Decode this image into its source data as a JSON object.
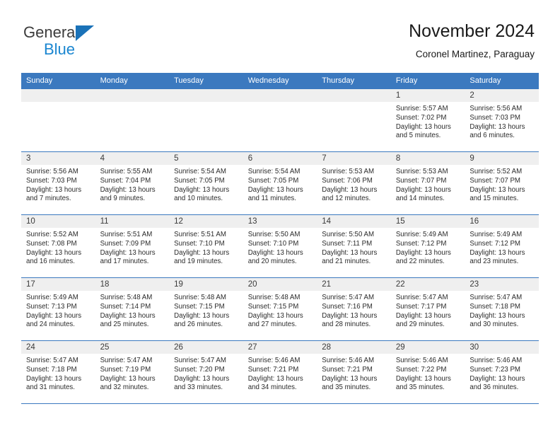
{
  "brand": {
    "name_top": "General",
    "name_bottom": "Blue",
    "accent_color": "#1a86d0",
    "triangle_color": "#1a72b8"
  },
  "header": {
    "title": "November 2024",
    "subtitle": "Coronel Martinez, Paraguay"
  },
  "theme": {
    "header_bg": "#3b79bf",
    "daynum_bg": "#efefef",
    "cell_bg": "#ffffff",
    "text_color": "#2b2b2b"
  },
  "weekdays": [
    "Sunday",
    "Monday",
    "Tuesday",
    "Wednesday",
    "Thursday",
    "Friday",
    "Saturday"
  ],
  "labels": {
    "sunrise": "Sunrise:",
    "sunset": "Sunset:",
    "daylight": "Daylight:"
  },
  "weeks": [
    [
      {
        "day": "",
        "sunrise": "",
        "sunset": "",
        "daylight1": "",
        "daylight2": ""
      },
      {
        "day": "",
        "sunrise": "",
        "sunset": "",
        "daylight1": "",
        "daylight2": ""
      },
      {
        "day": "",
        "sunrise": "",
        "sunset": "",
        "daylight1": "",
        "daylight2": ""
      },
      {
        "day": "",
        "sunrise": "",
        "sunset": "",
        "daylight1": "",
        "daylight2": ""
      },
      {
        "day": "",
        "sunrise": "",
        "sunset": "",
        "daylight1": "",
        "daylight2": ""
      },
      {
        "day": "1",
        "sunrise": "Sunrise: 5:57 AM",
        "sunset": "Sunset: 7:02 PM",
        "daylight1": "Daylight: 13 hours",
        "daylight2": "and 5 minutes."
      },
      {
        "day": "2",
        "sunrise": "Sunrise: 5:56 AM",
        "sunset": "Sunset: 7:03 PM",
        "daylight1": "Daylight: 13 hours",
        "daylight2": "and 6 minutes."
      }
    ],
    [
      {
        "day": "3",
        "sunrise": "Sunrise: 5:56 AM",
        "sunset": "Sunset: 7:03 PM",
        "daylight1": "Daylight: 13 hours",
        "daylight2": "and 7 minutes."
      },
      {
        "day": "4",
        "sunrise": "Sunrise: 5:55 AM",
        "sunset": "Sunset: 7:04 PM",
        "daylight1": "Daylight: 13 hours",
        "daylight2": "and 9 minutes."
      },
      {
        "day": "5",
        "sunrise": "Sunrise: 5:54 AM",
        "sunset": "Sunset: 7:05 PM",
        "daylight1": "Daylight: 13 hours",
        "daylight2": "and 10 minutes."
      },
      {
        "day": "6",
        "sunrise": "Sunrise: 5:54 AM",
        "sunset": "Sunset: 7:05 PM",
        "daylight1": "Daylight: 13 hours",
        "daylight2": "and 11 minutes."
      },
      {
        "day": "7",
        "sunrise": "Sunrise: 5:53 AM",
        "sunset": "Sunset: 7:06 PM",
        "daylight1": "Daylight: 13 hours",
        "daylight2": "and 12 minutes."
      },
      {
        "day": "8",
        "sunrise": "Sunrise: 5:53 AM",
        "sunset": "Sunset: 7:07 PM",
        "daylight1": "Daylight: 13 hours",
        "daylight2": "and 14 minutes."
      },
      {
        "day": "9",
        "sunrise": "Sunrise: 5:52 AM",
        "sunset": "Sunset: 7:07 PM",
        "daylight1": "Daylight: 13 hours",
        "daylight2": "and 15 minutes."
      }
    ],
    [
      {
        "day": "10",
        "sunrise": "Sunrise: 5:52 AM",
        "sunset": "Sunset: 7:08 PM",
        "daylight1": "Daylight: 13 hours",
        "daylight2": "and 16 minutes."
      },
      {
        "day": "11",
        "sunrise": "Sunrise: 5:51 AM",
        "sunset": "Sunset: 7:09 PM",
        "daylight1": "Daylight: 13 hours",
        "daylight2": "and 17 minutes."
      },
      {
        "day": "12",
        "sunrise": "Sunrise: 5:51 AM",
        "sunset": "Sunset: 7:10 PM",
        "daylight1": "Daylight: 13 hours",
        "daylight2": "and 19 minutes."
      },
      {
        "day": "13",
        "sunrise": "Sunrise: 5:50 AM",
        "sunset": "Sunset: 7:10 PM",
        "daylight1": "Daylight: 13 hours",
        "daylight2": "and 20 minutes."
      },
      {
        "day": "14",
        "sunrise": "Sunrise: 5:50 AM",
        "sunset": "Sunset: 7:11 PM",
        "daylight1": "Daylight: 13 hours",
        "daylight2": "and 21 minutes."
      },
      {
        "day": "15",
        "sunrise": "Sunrise: 5:49 AM",
        "sunset": "Sunset: 7:12 PM",
        "daylight1": "Daylight: 13 hours",
        "daylight2": "and 22 minutes."
      },
      {
        "day": "16",
        "sunrise": "Sunrise: 5:49 AM",
        "sunset": "Sunset: 7:12 PM",
        "daylight1": "Daylight: 13 hours",
        "daylight2": "and 23 minutes."
      }
    ],
    [
      {
        "day": "17",
        "sunrise": "Sunrise: 5:49 AM",
        "sunset": "Sunset: 7:13 PM",
        "daylight1": "Daylight: 13 hours",
        "daylight2": "and 24 minutes."
      },
      {
        "day": "18",
        "sunrise": "Sunrise: 5:48 AM",
        "sunset": "Sunset: 7:14 PM",
        "daylight1": "Daylight: 13 hours",
        "daylight2": "and 25 minutes."
      },
      {
        "day": "19",
        "sunrise": "Sunrise: 5:48 AM",
        "sunset": "Sunset: 7:15 PM",
        "daylight1": "Daylight: 13 hours",
        "daylight2": "and 26 minutes."
      },
      {
        "day": "20",
        "sunrise": "Sunrise: 5:48 AM",
        "sunset": "Sunset: 7:15 PM",
        "daylight1": "Daylight: 13 hours",
        "daylight2": "and 27 minutes."
      },
      {
        "day": "21",
        "sunrise": "Sunrise: 5:47 AM",
        "sunset": "Sunset: 7:16 PM",
        "daylight1": "Daylight: 13 hours",
        "daylight2": "and 28 minutes."
      },
      {
        "day": "22",
        "sunrise": "Sunrise: 5:47 AM",
        "sunset": "Sunset: 7:17 PM",
        "daylight1": "Daylight: 13 hours",
        "daylight2": "and 29 minutes."
      },
      {
        "day": "23",
        "sunrise": "Sunrise: 5:47 AM",
        "sunset": "Sunset: 7:18 PM",
        "daylight1": "Daylight: 13 hours",
        "daylight2": "and 30 minutes."
      }
    ],
    [
      {
        "day": "24",
        "sunrise": "Sunrise: 5:47 AM",
        "sunset": "Sunset: 7:18 PM",
        "daylight1": "Daylight: 13 hours",
        "daylight2": "and 31 minutes."
      },
      {
        "day": "25",
        "sunrise": "Sunrise: 5:47 AM",
        "sunset": "Sunset: 7:19 PM",
        "daylight1": "Daylight: 13 hours",
        "daylight2": "and 32 minutes."
      },
      {
        "day": "26",
        "sunrise": "Sunrise: 5:47 AM",
        "sunset": "Sunset: 7:20 PM",
        "daylight1": "Daylight: 13 hours",
        "daylight2": "and 33 minutes."
      },
      {
        "day": "27",
        "sunrise": "Sunrise: 5:46 AM",
        "sunset": "Sunset: 7:21 PM",
        "daylight1": "Daylight: 13 hours",
        "daylight2": "and 34 minutes."
      },
      {
        "day": "28",
        "sunrise": "Sunrise: 5:46 AM",
        "sunset": "Sunset: 7:21 PM",
        "daylight1": "Daylight: 13 hours",
        "daylight2": "and 35 minutes."
      },
      {
        "day": "29",
        "sunrise": "Sunrise: 5:46 AM",
        "sunset": "Sunset: 7:22 PM",
        "daylight1": "Daylight: 13 hours",
        "daylight2": "and 35 minutes."
      },
      {
        "day": "30",
        "sunrise": "Sunrise: 5:46 AM",
        "sunset": "Sunset: 7:23 PM",
        "daylight1": "Daylight: 13 hours",
        "daylight2": "and 36 minutes."
      }
    ]
  ]
}
